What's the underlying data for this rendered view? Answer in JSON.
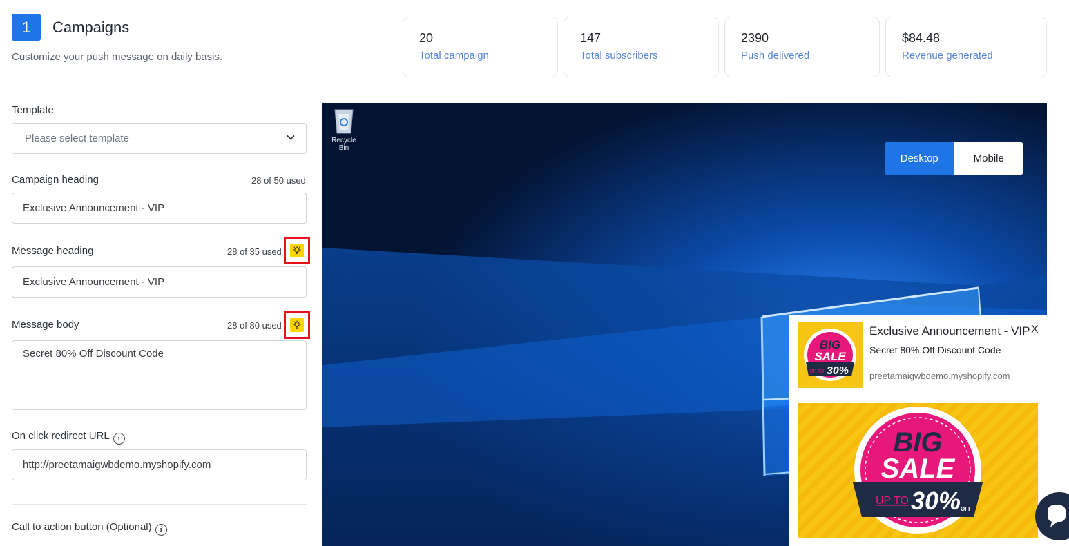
{
  "header": {
    "step": "1",
    "title": "Campaigns",
    "subtitle": "Customize your push message on daily basis."
  },
  "stats": [
    {
      "value": "20",
      "label": "Total campaign"
    },
    {
      "value": "147",
      "label": "Total subscribers"
    },
    {
      "value": "2390",
      "label": "Push delivered"
    },
    {
      "value": "$84.48",
      "label": "Revenue generated"
    }
  ],
  "form": {
    "template": {
      "label": "Template",
      "placeholder": "Please select template"
    },
    "campaign_heading": {
      "label": "Campaign heading",
      "count": "28 of 50 used",
      "value": "Exclusive Announcement - VIP"
    },
    "message_heading": {
      "label": "Message heading",
      "count": "28 of 35 used",
      "value": "Exclusive Announcement - VIP"
    },
    "message_body": {
      "label": "Message body",
      "count": "28 of 80 used",
      "value": "Secret 80% Off Discount Code"
    },
    "redirect_url": {
      "label": "On click redirect URL",
      "value": "http://preetamaigwbdemo.myshopify.com"
    },
    "cta": {
      "label": "Call to action button (Optional)"
    }
  },
  "preview": {
    "desktop_icon_label": "Recycle Bin",
    "toggle": {
      "desktop": "Desktop",
      "mobile": "Mobile",
      "selected": "Desktop"
    },
    "notification": {
      "title": "Exclusive Announcement - VIP",
      "close": "X",
      "body": "Secret 80% Off Discount Code",
      "domain": "preetamaigwbdemo.myshopify.com",
      "banner": {
        "big": "BIG",
        "sale": "SALE",
        "upto": "UP TO",
        "percent": "30%",
        "off": "OFF"
      }
    }
  },
  "colors": {
    "accent": "#1f74e6",
    "stat_label": "#5a86d6",
    "highlight": "#e8101a",
    "bulb": "#ffd400"
  },
  "icons": [
    "chevron-down-icon",
    "lightbulb-icon",
    "info-icon",
    "recycle-bin-icon",
    "chat-icon"
  ]
}
